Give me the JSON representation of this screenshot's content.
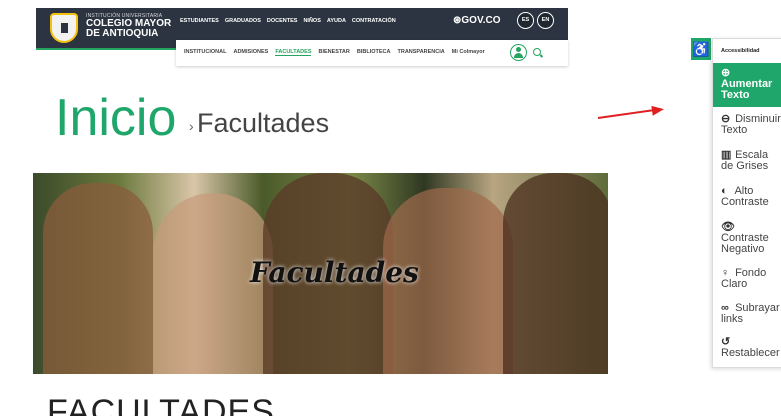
{
  "header": {
    "institution_small": "INSTITUCIÓN UNIVERSITARIA",
    "institution_line1": "COLEGIO MAYOR",
    "institution_line2": "DE ANTIOQUIA",
    "top_nav": [
      "ESTUDIANTES",
      "GRADUADOS",
      "DOCENTES",
      "NIÑOS",
      "AYUDA",
      "CONTRATACIÓN"
    ],
    "gov_label": "GOV.CO",
    "languages": [
      "ES",
      "EN"
    ]
  },
  "subnav": {
    "items": [
      "INSTITUCIONAL",
      "ADMISIONES",
      "FACULTADES",
      "BIENESTAR",
      "BIBLIOTECA",
      "TRANSPARENCIA",
      "Mi Colmayor"
    ],
    "active": "FACULTADES"
  },
  "main": {
    "title": "Inicio",
    "separator": "›",
    "subtitle": "Facultades",
    "hero_caption": "Facultades",
    "section_title": "FACULTADES"
  },
  "accessibility": {
    "header": "Accessibilidad",
    "items": [
      {
        "icon": "⊕",
        "line1": "Aumentar",
        "line2": "Texto",
        "active": true
      },
      {
        "icon": "⊖",
        "line1": "Disminuir",
        "line2": "Texto",
        "active": false
      },
      {
        "icon": "▥",
        "line1": "Escala",
        "line2": "de Grises",
        "active": false
      },
      {
        "icon": "◐",
        "line1": "Alto",
        "line2": "Contraste",
        "active": false
      },
      {
        "icon": "👁",
        "line1": "Contraste",
        "line2": "Negativo",
        "active": false
      },
      {
        "icon": "♀",
        "line1": "Fondo",
        "line2": "Claro",
        "active": false
      },
      {
        "icon": "∞",
        "line1": "Subrayar",
        "line2": "links",
        "active": false
      },
      {
        "icon": "↺",
        "line1": "",
        "line2": "Restablecer",
        "active": false
      }
    ]
  },
  "colors": {
    "brand_green": "#1fa66a",
    "topbar": "#2b3440",
    "annotation_red": "#e02020"
  }
}
